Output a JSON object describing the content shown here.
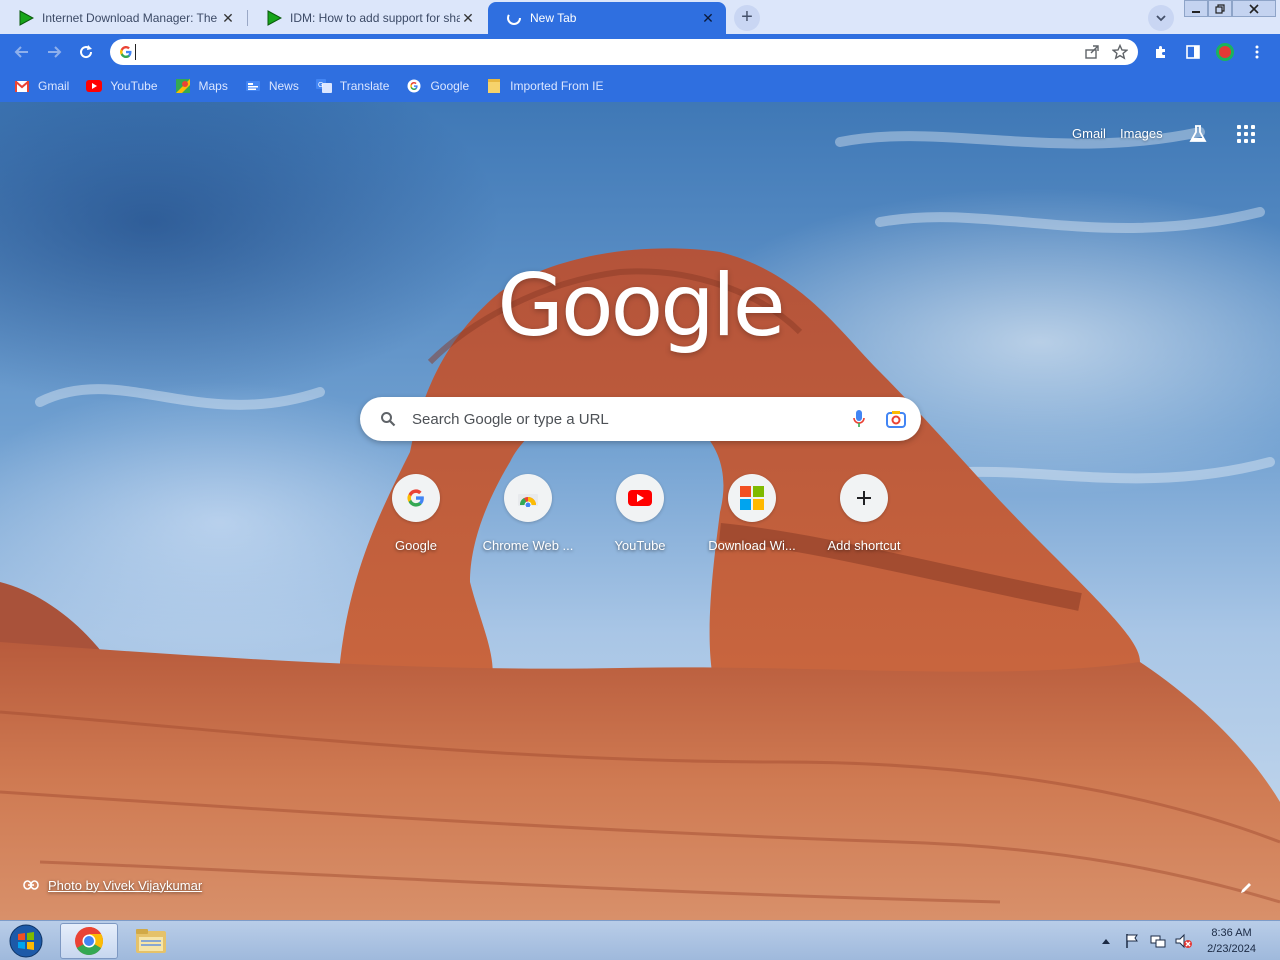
{
  "tabs": [
    {
      "title": "Internet Download Manager: The",
      "icon": "idm-play-icon",
      "active": false
    },
    {
      "title": "IDM: How to add support for sha",
      "icon": "idm-play-icon",
      "active": false
    },
    {
      "title": "New Tab",
      "icon": "loading-spinner-icon",
      "active": true
    }
  ],
  "toolbar": {
    "omnibox_value": "",
    "omnibox_icon": "google-g-icon"
  },
  "bookmarks": [
    {
      "label": "Gmail",
      "icon": "gmail-icon"
    },
    {
      "label": "YouTube",
      "icon": "youtube-icon"
    },
    {
      "label": "Maps",
      "icon": "maps-icon"
    },
    {
      "label": "News",
      "icon": "news-icon"
    },
    {
      "label": "Translate",
      "icon": "translate-icon"
    },
    {
      "label": "Google",
      "icon": "google-g-icon"
    },
    {
      "label": "Imported From IE",
      "icon": "folder-icon"
    }
  ],
  "ntp": {
    "gmail_link": "Gmail",
    "images_link": "Images",
    "logo_text": "Google",
    "search_placeholder": "Search Google or type a URL",
    "shortcuts": [
      {
        "label": "Google",
        "icon": "google-g-icon"
      },
      {
        "label": "Chrome Web ...",
        "icon": "chrome-web-store-icon"
      },
      {
        "label": "YouTube",
        "icon": "youtube-icon"
      },
      {
        "label": "Download Wi...",
        "icon": "microsoft-logo-icon"
      },
      {
        "label": "Add shortcut",
        "icon": "plus-icon"
      }
    ],
    "photo_credit": "Photo by Vivek Vijaykumar"
  },
  "taskbar": {
    "time": "8:36 AM",
    "date": "2/23/2024"
  },
  "colors": {
    "chrome_frame": "#2f6fe0",
    "tabstrip": "#dce6fa",
    "taskbar": "#b9cde8"
  }
}
